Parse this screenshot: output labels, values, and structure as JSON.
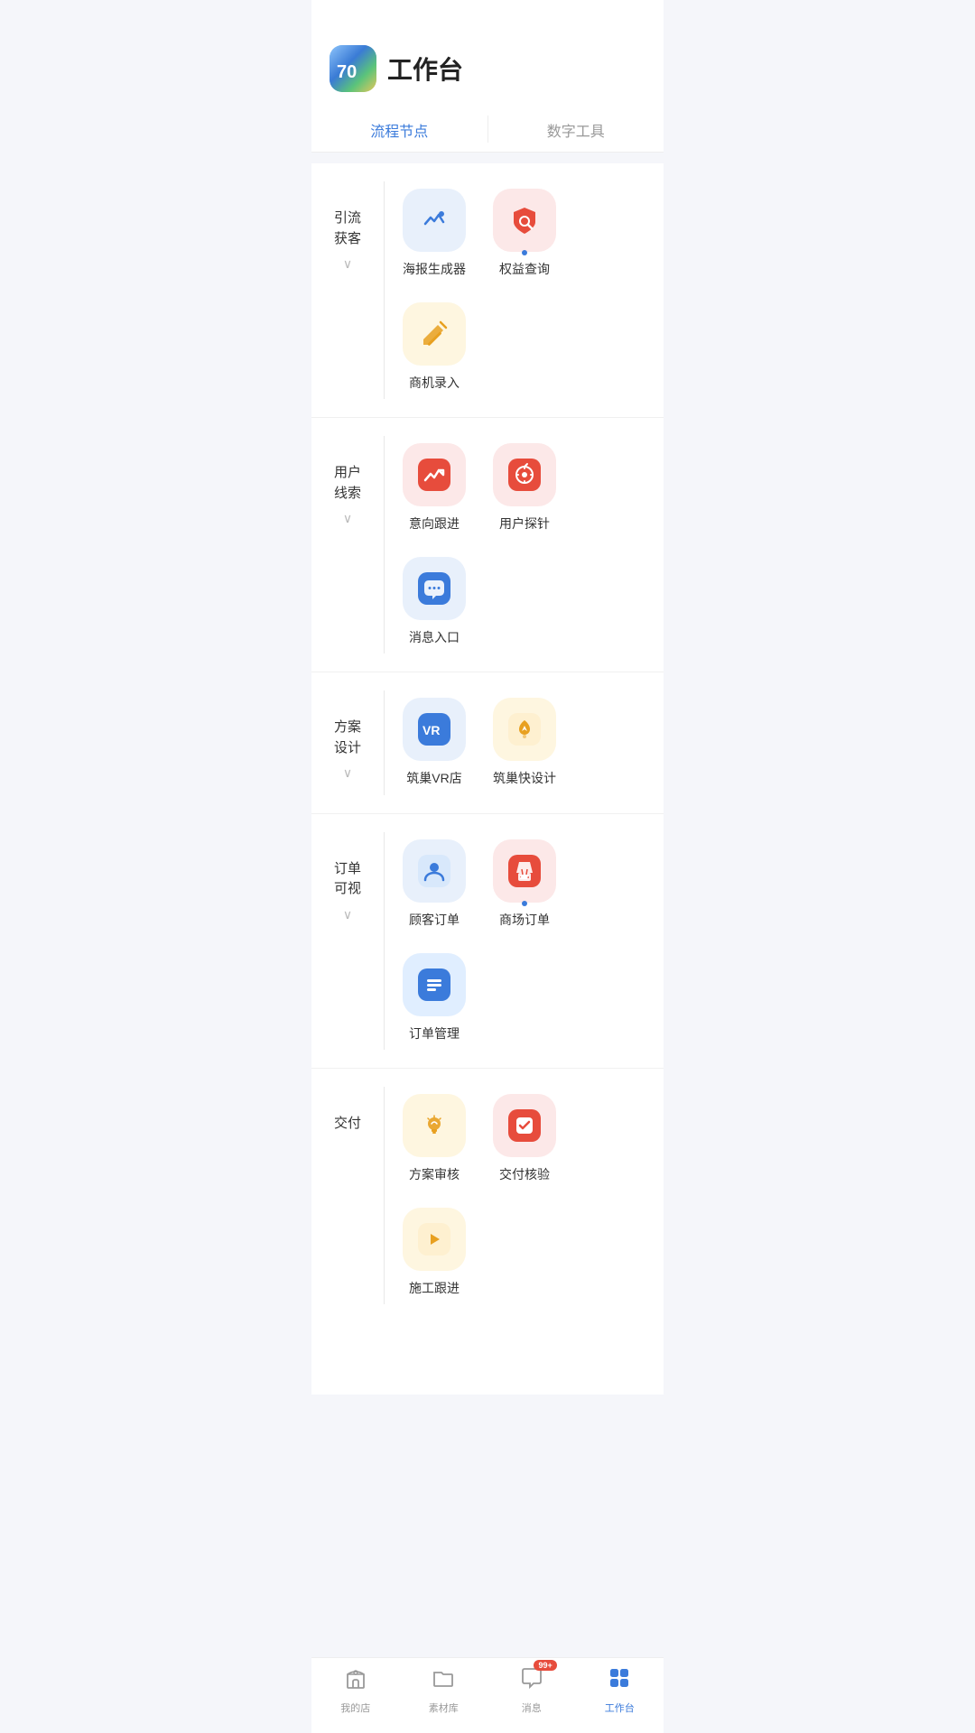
{
  "header": {
    "title": "工作台",
    "avatar_label": "70"
  },
  "tabs": [
    {
      "id": "flow",
      "label": "流程节点",
      "active": true
    },
    {
      "id": "digital",
      "label": "数字工具",
      "active": false
    }
  ],
  "sections": [
    {
      "id": "attract",
      "label": "引流\n获客",
      "items": [
        {
          "id": "poster",
          "label": "海报生成器",
          "bg": "blue-light",
          "icon_type": "trend",
          "has_dot": false
        },
        {
          "id": "rights",
          "label": "权益查询",
          "bg": "red-light",
          "icon_type": "search-shield",
          "has_dot": true
        },
        {
          "id": "opportunity",
          "label": "商机录入",
          "bg": "yellow-light",
          "icon_type": "pencil",
          "has_dot": false
        }
      ]
    },
    {
      "id": "leads",
      "label": "用户\n线索",
      "items": [
        {
          "id": "intention",
          "label": "意向跟进",
          "bg": "red-light",
          "icon_type": "chart-up",
          "has_dot": false
        },
        {
          "id": "probe",
          "label": "用户探针",
          "bg": "red-light",
          "icon_type": "compass",
          "has_dot": false
        },
        {
          "id": "message",
          "label": "消息入口",
          "bg": "blue-light",
          "icon_type": "chat",
          "has_dot": false
        }
      ]
    },
    {
      "id": "design",
      "label": "方案\n设计",
      "items": [
        {
          "id": "vr-shop",
          "label": "筑巢VR店",
          "bg": "blue-light",
          "icon_type": "vr",
          "has_dot": false
        },
        {
          "id": "quick-design",
          "label": "筑巢快设计",
          "bg": "yellow-light",
          "icon_type": "ribbon",
          "has_dot": false
        }
      ]
    },
    {
      "id": "order",
      "label": "订单\n可视",
      "items": [
        {
          "id": "customer-order",
          "label": "顾客订单",
          "bg": "blue-light",
          "icon_type": "person",
          "has_dot": false
        },
        {
          "id": "mall-order",
          "label": "商场订单",
          "bg": "red-light",
          "icon_type": "bag-check",
          "has_dot": true
        },
        {
          "id": "order-manage",
          "label": "订单管理",
          "bg": "blue2-light",
          "icon_type": "list",
          "has_dot": false
        }
      ]
    },
    {
      "id": "delivery",
      "label": "交付",
      "items": [
        {
          "id": "bulb",
          "label": "方案审核",
          "bg": "yellow-light",
          "icon_type": "bulb",
          "has_dot": false
        },
        {
          "id": "check-box",
          "label": "交付核验",
          "bg": "red-light",
          "icon_type": "check-box",
          "has_dot": false
        },
        {
          "id": "arrow-right",
          "label": "施工跟进",
          "bg": "yellow-light",
          "icon_type": "arrow-right",
          "has_dot": false
        }
      ]
    }
  ],
  "bottom_nav": [
    {
      "id": "my-shop",
      "label": "我的店",
      "icon_type": "shop",
      "active": false
    },
    {
      "id": "materials",
      "label": "素材库",
      "icon_type": "folder",
      "active": false
    },
    {
      "id": "messages",
      "label": "消息",
      "icon_type": "chat-bubble",
      "active": false,
      "badge": "99+"
    },
    {
      "id": "workbench",
      "label": "工作台",
      "icon_type": "grid",
      "active": true
    }
  ]
}
